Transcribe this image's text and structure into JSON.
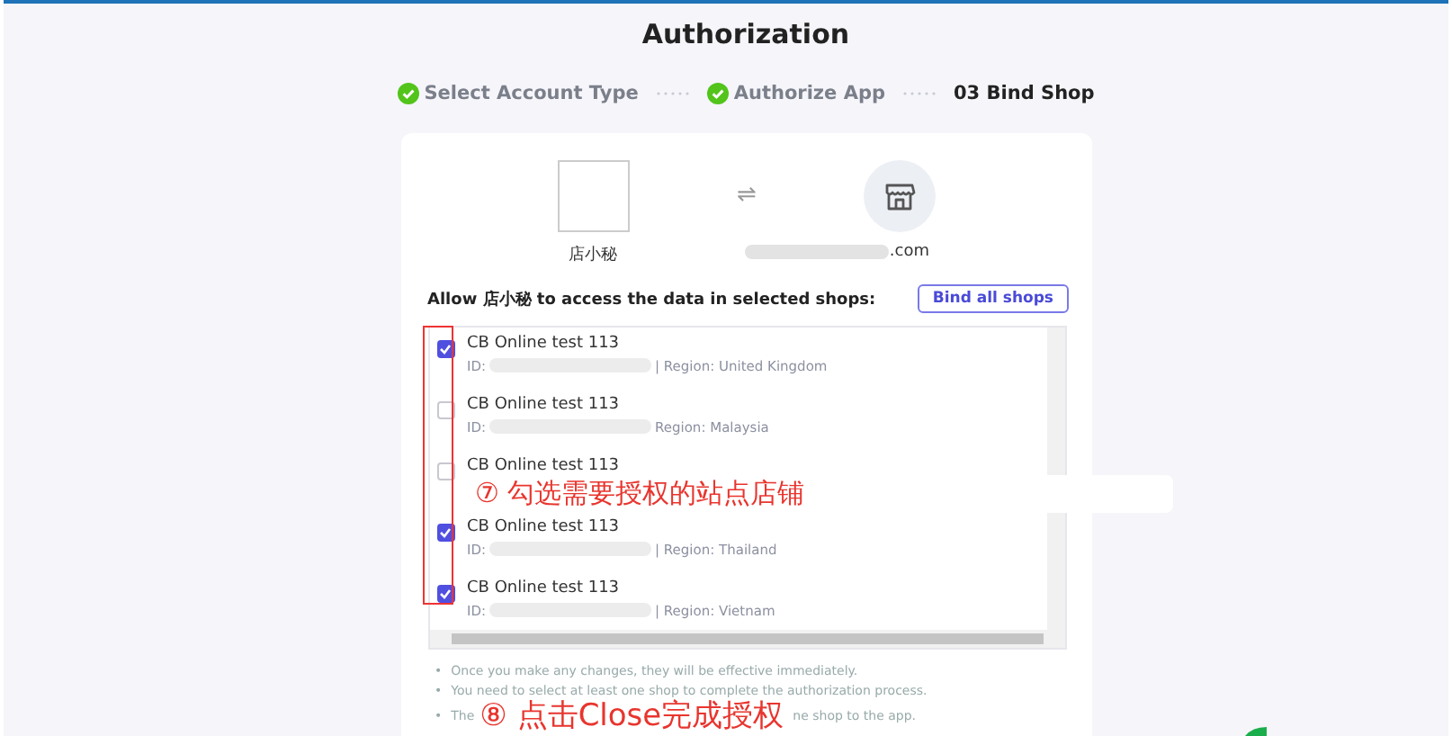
{
  "title": "Authorization",
  "steps": [
    {
      "label": "Select Account Type",
      "done": true
    },
    {
      "label": "Authorize App",
      "done": true
    },
    {
      "label": "03 Bind Shop",
      "done": false
    }
  ],
  "app_name": "店小秘",
  "arrows": "⇌",
  "shop_domain": ".com",
  "allow_text": "Allow 店小秘 to access the data in selected shops:",
  "bind_all_button": "Bind all shops",
  "shops": [
    {
      "name": "CB Online test 113",
      "id_label": "ID:",
      "region": "| Region: United Kingdom",
      "checked": true
    },
    {
      "name": "CB Online test 113",
      "id_label": "ID:",
      "region": "Region: Malaysia",
      "checked": false
    },
    {
      "name": "CB Online test 113",
      "checked": false
    },
    {
      "name": "CB Online test 113",
      "id_label": "ID:",
      "region": "| Region: Thailand",
      "checked": true
    },
    {
      "name": "CB Online test 113",
      "id_label": "ID:",
      "region": "| Region: Vietnam",
      "checked": true
    }
  ],
  "notes": [
    {
      "bullet": "•",
      "text": "Once you make any changes, they will be effective immediately."
    },
    {
      "bullet": "•",
      "text": "You need to select at least one shop to complete the authorization process."
    },
    {
      "bullet": "•",
      "text": "The",
      "text_after": "ne shop to the app."
    }
  ],
  "annotations": [
    {
      "text": "⑦ 勾选需要授权的站点店铺"
    },
    {
      "text": "⑧ 点击Close完成授权"
    }
  ]
}
